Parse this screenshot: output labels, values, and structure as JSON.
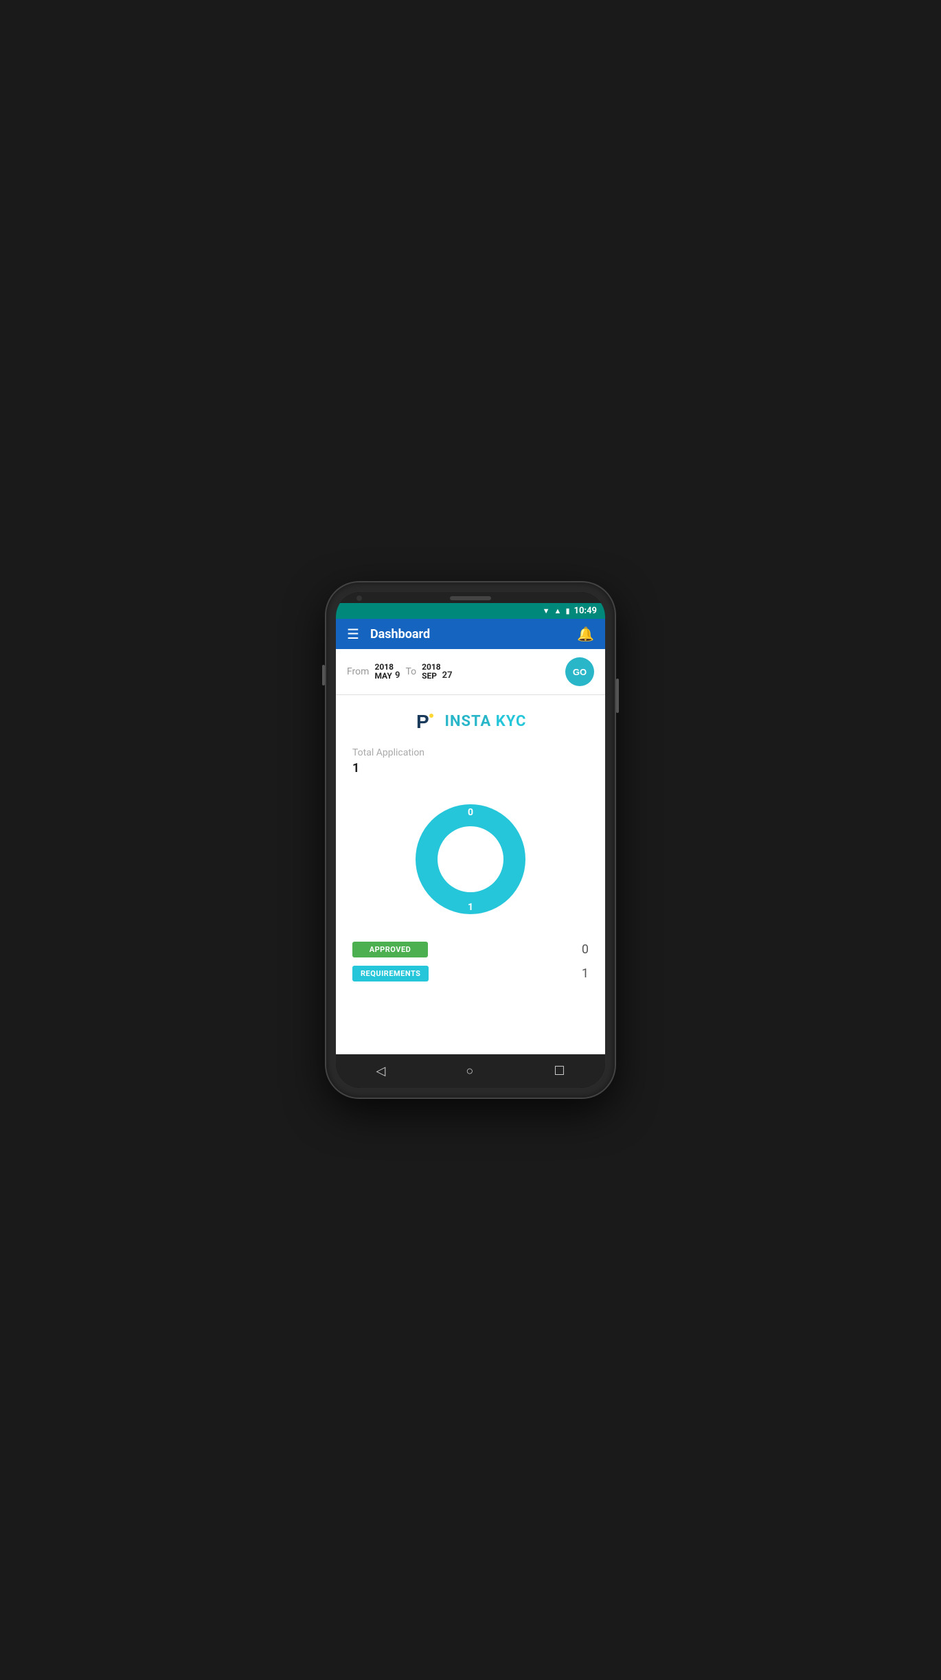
{
  "phone": {
    "status_bar": {
      "time": "10:49"
    },
    "header": {
      "title": "Dashboard",
      "menu_icon": "☰",
      "bell_icon": "🔔"
    },
    "date_filter": {
      "from_label": "From",
      "from_year": "2018",
      "from_month": "MAY",
      "from_day": "9",
      "to_label": "To",
      "to_year": "2018",
      "to_month": "SEP",
      "to_day": "27",
      "go_button": "GO"
    },
    "main": {
      "logo_text": "INSTA KYC",
      "total_label": "Total Application",
      "total_value": "1",
      "chart": {
        "label_top": "0",
        "label_bottom": "1",
        "color": "#26c6da"
      },
      "stats": [
        {
          "label": "APPROVED",
          "count": "0",
          "color": "approved"
        },
        {
          "label": "REQUIREMENTS",
          "count": "1",
          "color": "requirements"
        }
      ]
    },
    "bottom_nav": {
      "back": "◁",
      "home": "○",
      "recent": "☐"
    }
  }
}
